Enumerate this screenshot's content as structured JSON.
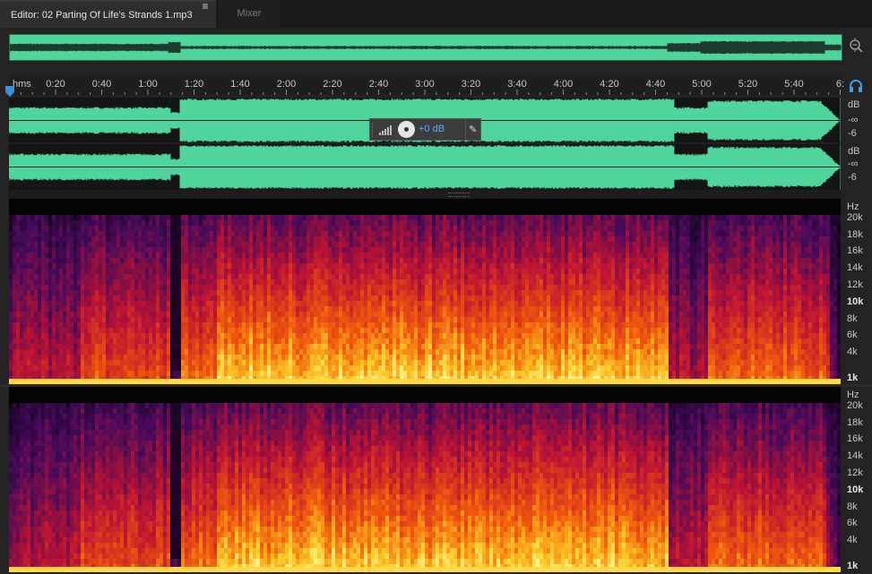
{
  "tabs": {
    "editor_label": "Editor: 02 Parting Of Life's Strands 1.mp3",
    "menu_glyph": "≡",
    "mixer_label": "Mixer"
  },
  "ruler": {
    "unit": "hms",
    "ticks": [
      "0:20",
      "0:40",
      "1:00",
      "1:20",
      "1:40",
      "2:00",
      "2:20",
      "2:40",
      "3:00",
      "3:20",
      "3:40",
      "4:00",
      "4:20",
      "4:40",
      "5:00",
      "5:20",
      "5:40",
      "6:"
    ]
  },
  "hud": {
    "gain_value": "+0 dB"
  },
  "db_scale": {
    "unit": "dB",
    "marks": [
      "-∞",
      "-6"
    ]
  },
  "hz_scale": {
    "unit": "Hz",
    "marks": [
      "20k",
      "18k",
      "16k",
      "14k",
      "12k",
      "10k",
      "8k",
      "6k",
      "4k",
      "1k"
    ]
  },
  "icons": {
    "overview_zoom": "zoom-magnifier-icon",
    "monitor": "headphone-icon",
    "hud_meter": "level-meter-icon",
    "hud_pin": "pin-icon"
  },
  "colors": {
    "waveform": "#4fd59c",
    "accent": "#2f8fd8",
    "hud_value": "#5ea8ff"
  }
}
